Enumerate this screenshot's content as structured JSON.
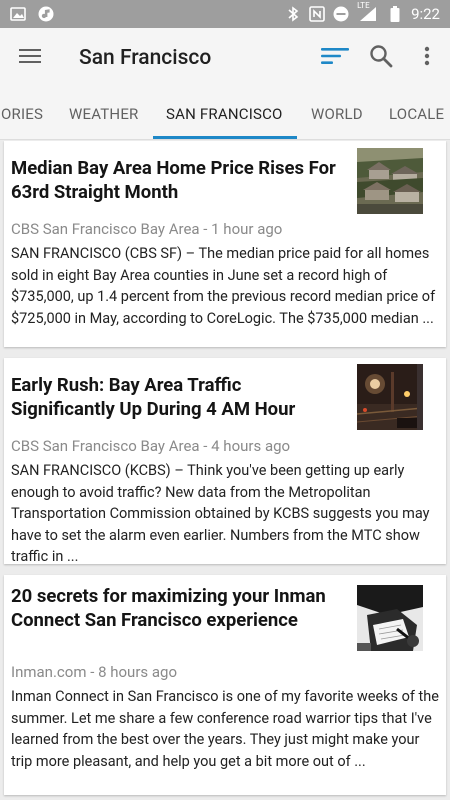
{
  "status": {
    "time": "9:22",
    "network_label": "LTE"
  },
  "app_bar": {
    "title": "San Francisco"
  },
  "tabs": [
    {
      "label": "ORIES"
    },
    {
      "label": "WEATHER"
    },
    {
      "label": "SAN FRANCISCO"
    },
    {
      "label": "WORLD"
    },
    {
      "label": "LOCALE"
    }
  ],
  "articles": [
    {
      "title": "Median Bay Area Home Price Rises For 63rd Straight Month",
      "source": "CBS San Francisco Bay Area",
      "age": "1 hour ago",
      "separator": " - ",
      "snippet": "SAN FRANCISCO (CBS SF) – The median price paid for all homes sold in eight Bay Area counties in June set a record high of $735,000, up 1.4 percent from the previous record median price of $725,000 in May, according to CoreLogic. The $735,000 median ...",
      "thumbnail": "houses-on-hillside-photo"
    },
    {
      "title": "Early Rush: Bay Area Traffic Significantly Up During 4 AM Hour",
      "source": "CBS San Francisco Bay Area",
      "age": "4 hours ago",
      "separator": " - ",
      "snippet": "SAN FRANCISCO (KCBS) – Think you've been getting up early enough to avoid traffic? New data from the Metropolitan Transportation Commission obtained by KCBS suggests you may have to set the alarm even earlier. Numbers from the MTC show traffic in ...",
      "thumbnail": "night-traffic-photo"
    },
    {
      "title": "20 secrets for maximizing your Inman Connect San Francisco experience",
      "source": "Inman.com",
      "age": "8 hours ago",
      "separator": " - ",
      "snippet": "Inman Connect in San Francisco is one of my favorite weeks of the summer. Let me share a few conference road warrior tips that I've learned from the best over the years. They just might make your trip more pleasant, and help you get a bit more out of ...",
      "thumbnail": "person-writing-photo"
    }
  ],
  "colors": {
    "accent": "#1e88c7",
    "status_bar": "#9e9e9e",
    "app_bar": "#f5f5f5"
  }
}
